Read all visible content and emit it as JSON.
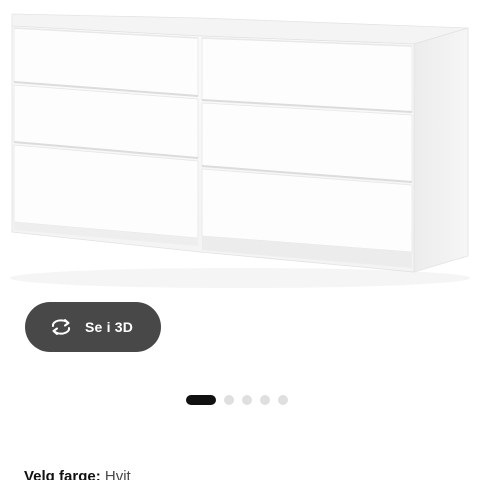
{
  "product": {
    "image_alt_icon": "dresser-6-drawer",
    "color_body": "#ffffff",
    "color_shadow": "#e9e9e9"
  },
  "view_3d": {
    "label": "Se i 3D",
    "icon": "rotate-3d-icon",
    "background": "#484848"
  },
  "carousel": {
    "total": 5,
    "active_index": 0
  },
  "color_selector": {
    "label": "Velg farge:",
    "value": "Hvit"
  }
}
